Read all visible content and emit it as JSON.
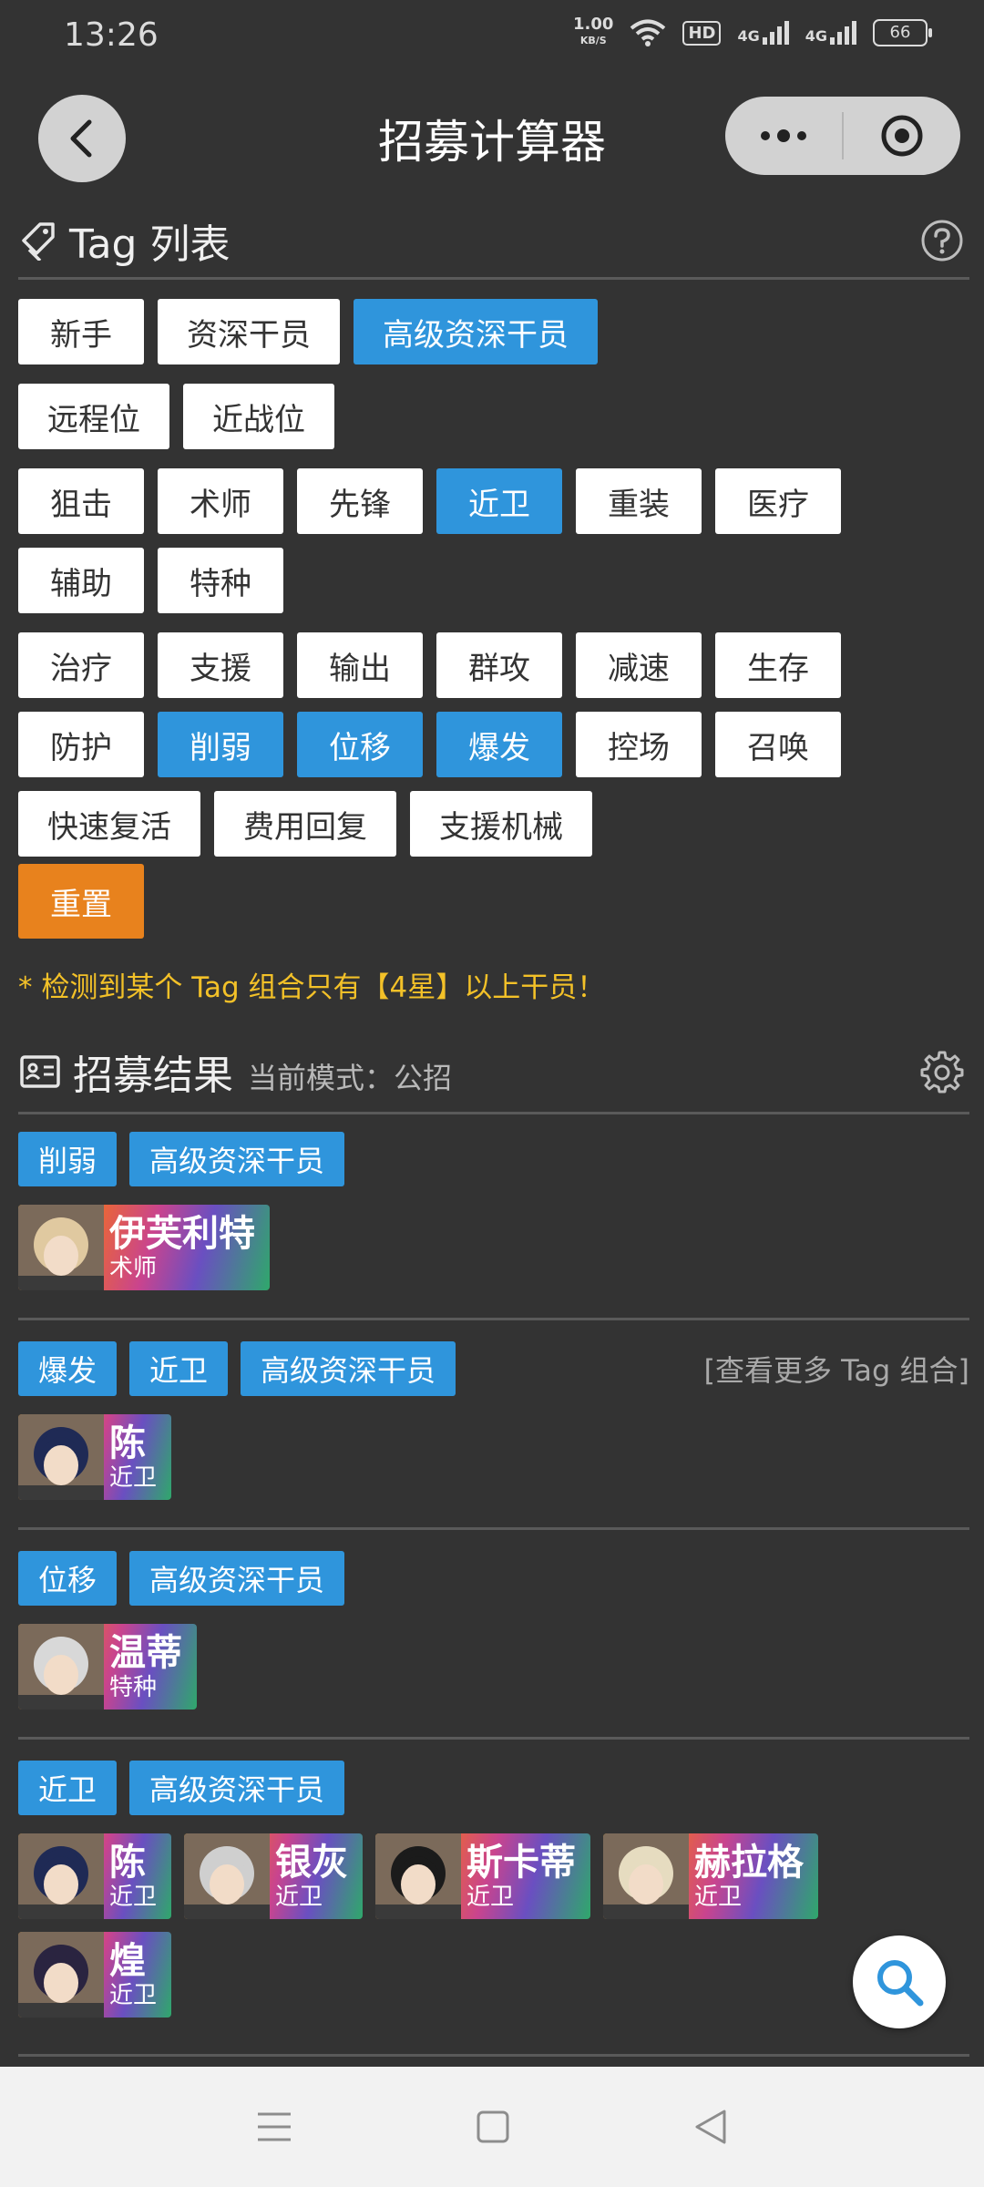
{
  "status": {
    "time": "13:26",
    "net_speed_value": "1.00",
    "net_speed_unit": "KB/S",
    "hd": "HD",
    "sim1": "4G",
    "sim2": "4G",
    "battery": "66"
  },
  "header": {
    "title": "招募计算器"
  },
  "tags_section": {
    "title": "Tag 列表"
  },
  "tag_groups": [
    [
      [
        {
          "label": "新手",
          "selected": false
        },
        {
          "label": "资深干员",
          "selected": false
        },
        {
          "label": "高级资深干员",
          "selected": true
        }
      ]
    ],
    [
      [
        {
          "label": "远程位",
          "selected": false
        },
        {
          "label": "近战位",
          "selected": false
        }
      ]
    ],
    [
      [
        {
          "label": "狙击",
          "selected": false
        },
        {
          "label": "术师",
          "selected": false
        },
        {
          "label": "先锋",
          "selected": false
        },
        {
          "label": "近卫",
          "selected": true
        },
        {
          "label": "重装",
          "selected": false
        },
        {
          "label": "医疗",
          "selected": false
        }
      ],
      [
        {
          "label": "辅助",
          "selected": false
        },
        {
          "label": "特种",
          "selected": false
        }
      ]
    ],
    [
      [
        {
          "label": "治疗",
          "selected": false
        },
        {
          "label": "支援",
          "selected": false
        },
        {
          "label": "输出",
          "selected": false
        },
        {
          "label": "群攻",
          "selected": false
        },
        {
          "label": "减速",
          "selected": false
        },
        {
          "label": "生存",
          "selected": false
        }
      ],
      [
        {
          "label": "防护",
          "selected": false
        },
        {
          "label": "削弱",
          "selected": true
        },
        {
          "label": "位移",
          "selected": true
        },
        {
          "label": "爆发",
          "selected": true
        },
        {
          "label": "控场",
          "selected": false
        },
        {
          "label": "召唤",
          "selected": false
        }
      ],
      [
        {
          "label": "快速复活",
          "selected": false
        },
        {
          "label": "费用回复",
          "selected": false
        },
        {
          "label": "支援机械",
          "selected": false
        }
      ]
    ]
  ],
  "reset_label": "重置",
  "warning": "* 检测到某个 Tag 组合只有【4星】以上干员！",
  "results_section": {
    "title": "招募结果",
    "mode": "当前模式：公招"
  },
  "results": [
    {
      "tags": [
        "削弱",
        "高级资深干员"
      ],
      "more": "",
      "operators": [
        {
          "name": "伊芙利特",
          "class": "术师"
        }
      ]
    },
    {
      "tags": [
        "爆发",
        "近卫",
        "高级资深干员"
      ],
      "more": "[查看更多 Tag 组合]",
      "operators": [
        {
          "name": "陈",
          "class": "近卫"
        }
      ]
    },
    {
      "tags": [
        "位移",
        "高级资深干员"
      ],
      "more": "",
      "operators": [
        {
          "name": "温蒂",
          "class": "特种"
        }
      ]
    },
    {
      "tags": [
        "近卫",
        "高级资深干员"
      ],
      "more": "",
      "operators": [
        {
          "name": "陈",
          "class": "近卫"
        },
        {
          "name": "银灰",
          "class": "近卫"
        },
        {
          "name": "斯卡蒂",
          "class": "近卫"
        },
        {
          "name": "赫拉格",
          "class": "近卫"
        },
        {
          "name": "煌",
          "class": "近卫"
        }
      ]
    }
  ],
  "colors": {
    "background": "#333333",
    "tag_selected": "#2f95dc",
    "reset": "#e8821d",
    "warning": "#f3c128"
  }
}
